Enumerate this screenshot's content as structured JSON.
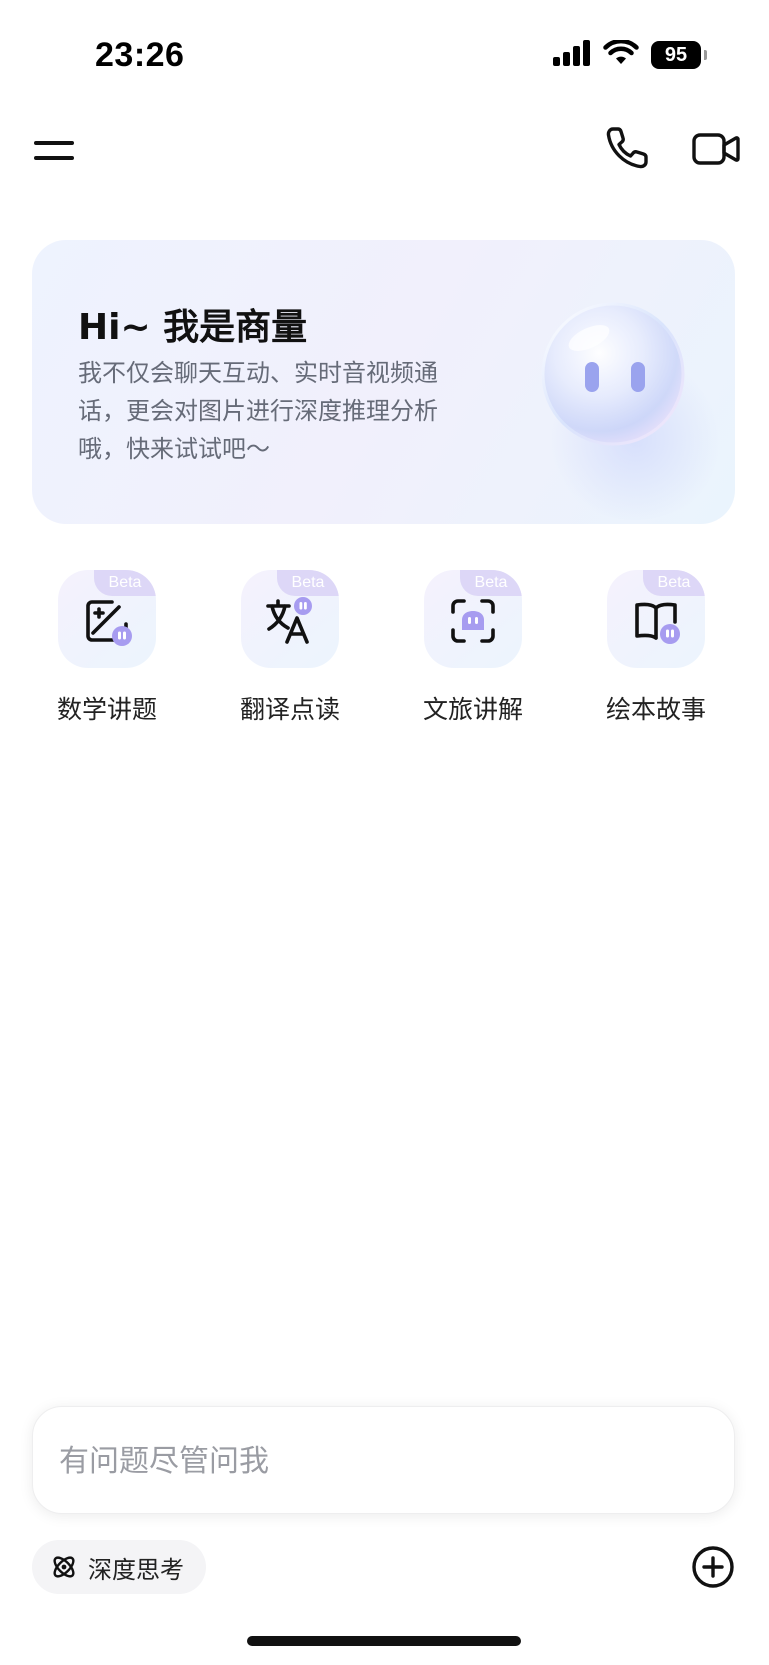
{
  "status_bar": {
    "time": "23:26",
    "battery": "95",
    "icons": [
      "signal-icon",
      "wifi-icon",
      "battery-icon"
    ]
  },
  "top_bar": {
    "icons": [
      "menu-icon",
      "phone-icon",
      "video-call-icon"
    ]
  },
  "hero": {
    "title": "Hi~ 我是商量",
    "description": "我不仅会聊天互动、实时音视频通话，更会对图片进行深度推理分析哦，快来试试吧～"
  },
  "features": [
    {
      "label": "数学讲题",
      "badge": "Beta",
      "icon": "math-image-icon"
    },
    {
      "label": "翻译点读",
      "badge": "Beta",
      "icon": "translate-icon"
    },
    {
      "label": "文旅讲解",
      "badge": "Beta",
      "icon": "scan-guide-icon"
    },
    {
      "label": "绘本故事",
      "badge": "Beta",
      "icon": "picture-book-icon"
    }
  ],
  "input": {
    "placeholder": "有问题尽管问我",
    "value": ""
  },
  "deep_think": {
    "label": "深度思考",
    "icon": "atom-icon"
  },
  "add_button": {
    "icon": "plus-circle-icon"
  },
  "colors": {
    "accent": "#8f85e6",
    "badge_bg": "#ddd7f7",
    "hero_bg": "#eef3fe",
    "text_secondary": "#666b78"
  }
}
